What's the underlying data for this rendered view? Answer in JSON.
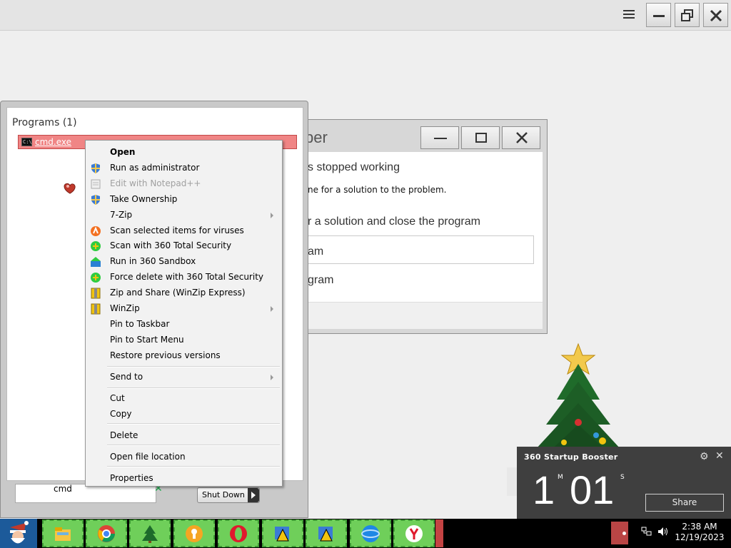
{
  "window_controls": {
    "menu_icon": "hamburger-icon",
    "minimize_icon": "minimize-icon",
    "restore_icon": "restore-icon",
    "close_icon": "close-icon"
  },
  "crash_dialog": {
    "title_fragment": "per",
    "stopped_text": "s stopped working",
    "check_text": "ne for a solution to the problem.",
    "solution_text": "r a solution and close the program",
    "close_text": "am",
    "debug_text": "gram"
  },
  "start_menu": {
    "programs_heading": "Programs (1)",
    "result": {
      "label": "cmd.exe",
      "icon": "cmd-icon",
      "icon_text": "C:\\"
    },
    "search_value": "cmd",
    "clear_icon": "clear-x-icon",
    "shutdown_label": "Shut Down"
  },
  "context_menu": {
    "items": [
      {
        "label": "Open",
        "icon": "",
        "bold": true,
        "disabled": false,
        "submenu": false
      },
      {
        "label": "Run as administrator",
        "icon": "uac-shield-icon",
        "bold": false,
        "disabled": false,
        "submenu": false
      },
      {
        "label": "Edit with Notepad++",
        "icon": "notepad-plus-plus-icon",
        "bold": false,
        "disabled": true,
        "submenu": false
      },
      {
        "label": "Take Ownership",
        "icon": "uac-shield-icon",
        "bold": false,
        "disabled": false,
        "submenu": false
      },
      {
        "label": "7-Zip",
        "icon": "",
        "bold": false,
        "disabled": false,
        "submenu": true
      },
      {
        "label": "Scan selected items for viruses",
        "icon": "avast-icon",
        "bold": false,
        "disabled": false,
        "submenu": false
      },
      {
        "label": "Scan with 360 Total Security",
        "icon": "360-security-icon",
        "bold": false,
        "disabled": false,
        "submenu": false
      },
      {
        "label": "Run in 360 Sandbox",
        "icon": "360-sandbox-icon",
        "bold": false,
        "disabled": false,
        "submenu": false
      },
      {
        "label": "Force delete with 360 Total Security",
        "icon": "360-security-icon",
        "bold": false,
        "disabled": false,
        "submenu": false
      },
      {
        "label": "Zip and Share (WinZip Express)",
        "icon": "winzip-icon",
        "bold": false,
        "disabled": false,
        "submenu": false
      },
      {
        "label": "WinZip",
        "icon": "winzip-icon",
        "bold": false,
        "disabled": false,
        "submenu": true
      },
      {
        "label": "Pin to Taskbar",
        "icon": "",
        "bold": false,
        "disabled": false,
        "submenu": false
      },
      {
        "label": "Pin to Start Menu",
        "icon": "",
        "bold": false,
        "disabled": false,
        "submenu": false
      },
      {
        "label": "Restore previous versions",
        "icon": "",
        "bold": false,
        "disabled": false,
        "submenu": false
      },
      {
        "label": "Send to",
        "icon": "",
        "bold": false,
        "disabled": false,
        "submenu": true
      },
      {
        "label": "Cut",
        "icon": "",
        "bold": false,
        "disabled": false,
        "submenu": false
      },
      {
        "label": "Copy",
        "icon": "",
        "bold": false,
        "disabled": false,
        "submenu": false
      },
      {
        "label": "Delete",
        "icon": "",
        "bold": false,
        "disabled": false,
        "submenu": false
      },
      {
        "label": "Open file location",
        "icon": "",
        "bold": false,
        "disabled": false,
        "submenu": false
      },
      {
        "label": "Properties",
        "icon": "",
        "bold": false,
        "disabled": false,
        "submenu": false
      }
    ]
  },
  "booster": {
    "title": "360 Startup Booster",
    "minutes": "1",
    "minutes_unit": "M",
    "seconds": "01",
    "seconds_unit": "S",
    "share_label": "Share",
    "settings_icon": "gear-icon",
    "close_icon": "close-icon"
  },
  "taskbar": {
    "start_icon": "santa-start-icon",
    "pinned": [
      {
        "name": "file-explorer-icon"
      },
      {
        "name": "chrome-icon"
      },
      {
        "name": "christmas-tree-icon"
      },
      {
        "name": "keyhole-app-icon"
      },
      {
        "name": "opera-icon"
      },
      {
        "name": "shield-app-icon"
      },
      {
        "name": "shield-app-icon-2"
      },
      {
        "name": "globe-browser-icon"
      },
      {
        "name": "yandex-icon"
      }
    ],
    "tray": {
      "network_icon": "network-icon",
      "volume_icon": "volume-icon"
    },
    "clock": {
      "time": "2:38 AM",
      "date": "12/19/2023"
    }
  },
  "colors": {
    "highlight": "#f08585",
    "taskbar_item": "#6fcf5a",
    "booster_bg": "#3f3f3f"
  }
}
